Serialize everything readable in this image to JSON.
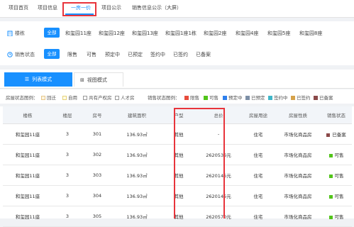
{
  "nav": {
    "tabs": [
      "项目首页",
      "项目信息",
      "一房一价",
      "项目公示",
      "销售信息公示（大屏）"
    ],
    "active_index": 2
  },
  "filters": {
    "building": {
      "label": "楼栋",
      "all_label": "全部",
      "options": [
        "和玺园11座",
        "和玺园12座",
        "和玺园13座",
        "和玺园1座1栋",
        "和玺园2座",
        "和玺园4座",
        "和玺园5座",
        "和玺园8座"
      ]
    },
    "sale_status": {
      "label": "销售状态",
      "all_label": "全部",
      "options": [
        "限售",
        "可售",
        "预定中",
        "已预定",
        "签约中",
        "已签约",
        "已备案"
      ]
    }
  },
  "view_modes": {
    "list": "列表模式",
    "view": "视图模式"
  },
  "legend": {
    "house_status_label": "房屋状态图例：",
    "house_status": [
      {
        "label": "回迁",
        "color": "#fdf4e0"
      },
      {
        "label": "自用",
        "color": "#fffbe6"
      },
      {
        "label": "共有产权房",
        "color": "#ffffff"
      },
      {
        "label": "人才房",
        "color": "#ffffff"
      }
    ],
    "sale_status_label": "销售状态图例：",
    "sale_status": [
      {
        "label": "限售",
        "color": "#e74c3c"
      },
      {
        "label": "可售",
        "color": "#52c41a"
      },
      {
        "label": "预定中",
        "color": "#2f80ed"
      },
      {
        "label": "已预定",
        "color": "#7d8fa6"
      },
      {
        "label": "签约中",
        "color": "#3fb6c8"
      },
      {
        "label": "已签约",
        "color": "#d6a24a"
      },
      {
        "label": "已备案",
        "color": "#8b4a4a"
      }
    ]
  },
  "table": {
    "headers": [
      "楼栋",
      "楼层",
      "房号",
      "建筑面积",
      "户型",
      "总价",
      "房屋用途",
      "房屋性质",
      "销售状态"
    ],
    "rows": [
      {
        "building": "和玺园11座",
        "floor": "3",
        "room": "301",
        "area": "136.93㎡",
        "type": "其他",
        "price": "-",
        "use": "住宅",
        "nature": "市场化商品房",
        "status": "已备案",
        "status_color": "#8b4a4a"
      },
      {
        "building": "和玺园11座",
        "floor": "3",
        "room": "302",
        "area": "136.93㎡",
        "type": "其他",
        "price": "2620536元",
        "use": "住宅",
        "nature": "市场化商品房",
        "status": "可售",
        "status_color": "#52c41a"
      },
      {
        "building": "和玺园11座",
        "floor": "3",
        "room": "303",
        "area": "136.93㎡",
        "type": "其他",
        "price": "2620145元",
        "use": "住宅",
        "nature": "市场化商品房",
        "status": "可售",
        "status_color": "#52c41a"
      },
      {
        "building": "和玺园11座",
        "floor": "3",
        "room": "304",
        "area": "136.93㎡",
        "type": "其他",
        "price": "2620145元",
        "use": "住宅",
        "nature": "市场化商品房",
        "status": "可售",
        "status_color": "#52c41a"
      },
      {
        "building": "和玺园11座",
        "floor": "3",
        "room": "305",
        "area": "136.93㎡",
        "type": "其他",
        "price": "2620570元",
        "use": "住宅",
        "nature": "市场化商品房",
        "status": "可售",
        "status_color": "#52c41a"
      }
    ]
  },
  "colors": {
    "accent": "#1890ff",
    "highlight": "#e8343b"
  }
}
